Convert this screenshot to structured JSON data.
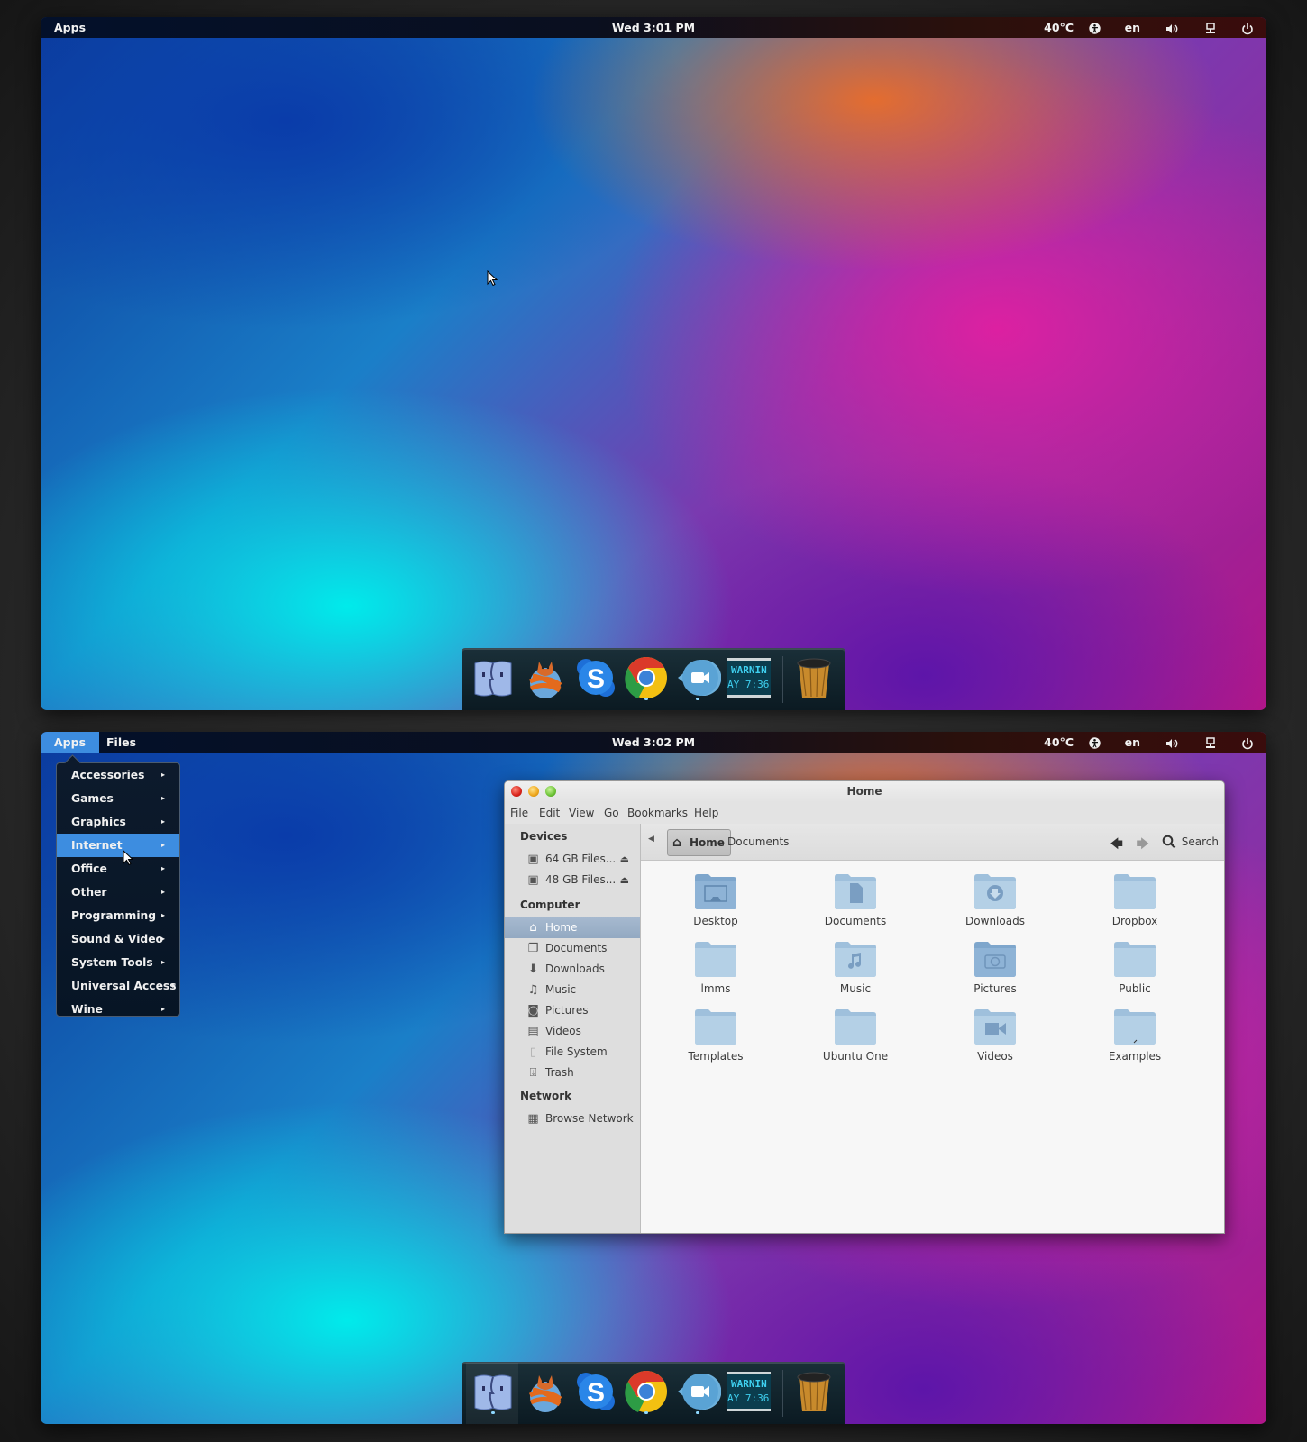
{
  "screen1": {
    "topbar": {
      "apps_label": "Apps",
      "clock": "Wed  3:01 PM",
      "temperature": "40°C",
      "accessibility_icon": "accessibility-icon",
      "language": "en",
      "volume_icon": "volume-icon",
      "network_icon": "network-icon",
      "power_icon": "power-icon"
    },
    "dock": {
      "apps": [
        {
          "name": "Finder",
          "icon": "finder-icon",
          "running": false
        },
        {
          "name": "Firefox",
          "icon": "firefox-icon",
          "running": false
        },
        {
          "name": "Skype",
          "icon": "skype-icon",
          "running": false
        },
        {
          "name": "Google Chrome",
          "icon": "chrome-icon",
          "running": true
        },
        {
          "name": "Video Chat",
          "icon": "video-chat-icon",
          "running": true
        },
        {
          "name": "Console",
          "icon": "console-icon",
          "text_line1": "WARNIN",
          "text_line2": "AY 7:36",
          "running": false
        },
        {
          "name": "Trash",
          "icon": "trash-icon",
          "running": false
        }
      ]
    }
  },
  "screen2": {
    "topbar": {
      "apps_label": "Apps",
      "files_label": "Files",
      "clock": "Wed  3:02 PM",
      "temperature": "40°C",
      "language": "en"
    },
    "apps_menu": {
      "items": [
        {
          "label": "Accessories",
          "highlighted": false
        },
        {
          "label": "Games",
          "highlighted": false
        },
        {
          "label": "Graphics",
          "highlighted": false
        },
        {
          "label": "Internet",
          "highlighted": true
        },
        {
          "label": "Office",
          "highlighted": false
        },
        {
          "label": "Other",
          "highlighted": false
        },
        {
          "label": "Programming",
          "highlighted": false
        },
        {
          "label": "Sound & Video",
          "highlighted": false
        },
        {
          "label": "System Tools",
          "highlighted": false
        },
        {
          "label": "Universal Access",
          "highlighted": false
        },
        {
          "label": "Wine",
          "highlighted": false
        }
      ],
      "arrow": "▸"
    },
    "file_manager": {
      "title": "Home",
      "menu": [
        "File",
        "Edit",
        "View",
        "Go",
        "Bookmarks",
        "Help"
      ],
      "sidebar": {
        "devices_heading": "Devices",
        "devices": [
          {
            "label": "64 GB Files...",
            "icon": "drive-icon"
          },
          {
            "label": "48 GB Files...",
            "icon": "drive-icon"
          }
        ],
        "computer_heading": "Computer",
        "computer": [
          {
            "label": "Home",
            "icon": "home-icon",
            "selected": true
          },
          {
            "label": "Documents",
            "icon": "documents-icon"
          },
          {
            "label": "Downloads",
            "icon": "downloads-icon"
          },
          {
            "label": "Music",
            "icon": "music-icon"
          },
          {
            "label": "Pictures",
            "icon": "camera-icon"
          },
          {
            "label": "Videos",
            "icon": "film-icon"
          },
          {
            "label": "File System",
            "icon": "filesystem-icon"
          },
          {
            "label": "Trash",
            "icon": "trash-icon"
          }
        ],
        "network_heading": "Network",
        "network": [
          {
            "label": "Browse Network",
            "icon": "network-icon"
          }
        ]
      },
      "pathbar": {
        "crumbs": [
          "Home",
          "Documents"
        ],
        "search_label": "Search"
      },
      "folders": [
        {
          "label": "Desktop",
          "emblem": "desktop"
        },
        {
          "label": "Documents",
          "emblem": "document"
        },
        {
          "label": "Downloads",
          "emblem": "download"
        },
        {
          "label": "Dropbox",
          "emblem": "none"
        },
        {
          "label": "lmms",
          "emblem": "none"
        },
        {
          "label": "Music",
          "emblem": "music"
        },
        {
          "label": "Pictures",
          "emblem": "camera"
        },
        {
          "label": "Public",
          "emblem": "none"
        },
        {
          "label": "Templates",
          "emblem": "none"
        },
        {
          "label": "Ubuntu One",
          "emblem": "none"
        },
        {
          "label": "Videos",
          "emblem": "video"
        },
        {
          "label": "Examples",
          "emblem": "link"
        }
      ]
    }
  }
}
